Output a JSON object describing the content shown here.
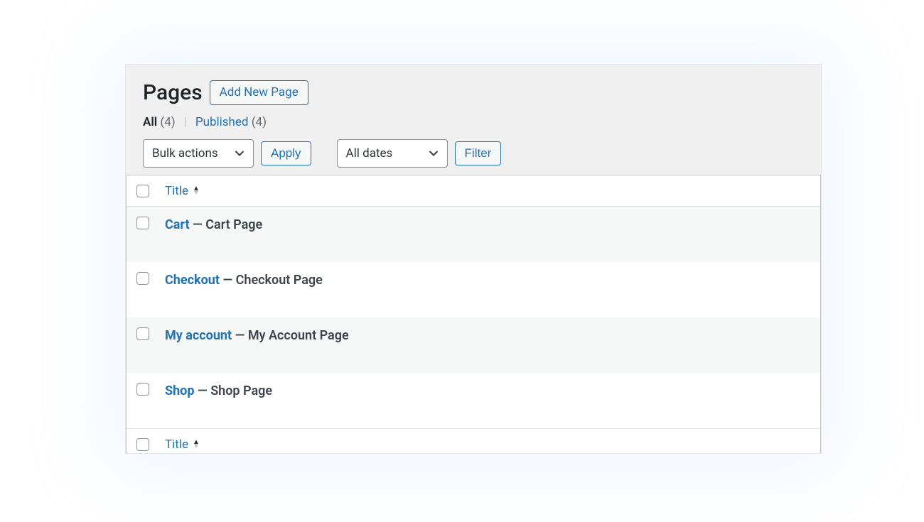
{
  "header": {
    "title": "Pages",
    "add_new_label": "Add New Page"
  },
  "filters": {
    "all_label": "All",
    "all_count": "(4)",
    "separator": "|",
    "published_label": "Published",
    "published_count": "(4)"
  },
  "controls": {
    "bulk_actions_label": "Bulk actions",
    "apply_label": "Apply",
    "all_dates_label": "All dates",
    "filter_label": "Filter"
  },
  "table": {
    "column_title": "Title",
    "rows": [
      {
        "link": "Cart",
        "suffix": " — Cart Page"
      },
      {
        "link": "Checkout",
        "suffix": " — Checkout Page"
      },
      {
        "link": "My account",
        "suffix": " — My Account Page"
      },
      {
        "link": "Shop",
        "suffix": " — Shop Page"
      }
    ]
  }
}
